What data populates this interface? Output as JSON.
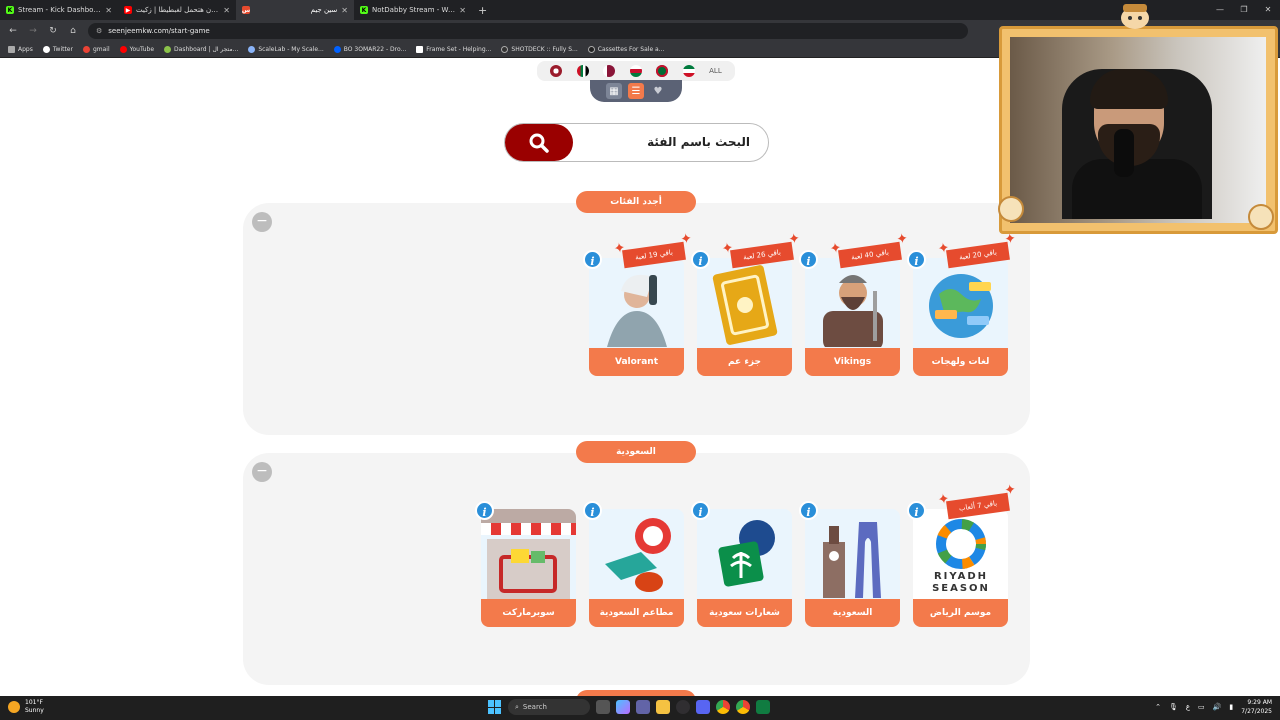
{
  "browser": {
    "tabs": [
      {
        "label": "Stream - Kick Dashboard",
        "icon": "kick-icon",
        "color": "#53fc18"
      },
      {
        "label": "مهرجان هتحمل لغبطيطا | زكيت",
        "icon": "youtube-icon",
        "color": "#ff0000"
      },
      {
        "label": "سين جيم",
        "icon": "seenjeem-icon",
        "color": "#e64b2e"
      },
      {
        "label": "NotDabby Stream - Watch Live",
        "icon": "kick-icon",
        "color": "#53fc18"
      }
    ],
    "url": "seenjeemkw.com/start-game",
    "bookmarks": [
      {
        "label": "Apps"
      },
      {
        "label": "Twitter"
      },
      {
        "label": "gmail"
      },
      {
        "label": "YouTube"
      },
      {
        "label": "Dashboard | متجر ال..."
      },
      {
        "label": "ScaleLab - My Scale..."
      },
      {
        "label": "BO 3OMAR22 - Dro..."
      },
      {
        "label": "Frame Set - Helping..."
      },
      {
        "label": "SHOTDECK :: Fully S..."
      },
      {
        "label": "Cassettes For Sale a..."
      }
    ]
  },
  "filters": {
    "all_label": "ALL",
    "flag_colors": [
      "#9b1c2c",
      "#007a3d",
      "#8a1538",
      "#c8102e",
      "#006c35",
      "#007a3d"
    ]
  },
  "search": {
    "placeholder": "البحث باسم الفئة"
  },
  "sections": [
    {
      "title": "أجدد الفئات",
      "cards": [
        {
          "label": "لغات ولهجات",
          "badge": "باقي 20 لعبة"
        },
        {
          "label": "Vikings",
          "badge": "باقي 40 لعبة"
        },
        {
          "label": "جزء عم",
          "badge": "باقي 26 لعبة"
        },
        {
          "label": "Valorant",
          "badge": "باقي 19 لعبة"
        }
      ]
    },
    {
      "title": "السعودية",
      "cards": [
        {
          "label": "موسم الرياض",
          "badge": "باقي 7 ألعاب",
          "art_text": "RIYADH SEASON"
        },
        {
          "label": "السعودية",
          "badge": ""
        },
        {
          "label": "شعارات سعودية",
          "badge": ""
        },
        {
          "label": "مطاعم السعودية",
          "badge": ""
        },
        {
          "label": "سوبرماركت",
          "badge": ""
        }
      ]
    }
  ],
  "taskbar": {
    "weather_temp": "101°F",
    "weather_desc": "Sunny",
    "search_label": "Search",
    "time": "9:29 AM",
    "date": "7/27/2025",
    "lang": "ع"
  },
  "colors": {
    "accent": "#f37a4b",
    "search_button": "#9a0000",
    "info": "#2a8fd9",
    "badge": "#e64b2e"
  }
}
